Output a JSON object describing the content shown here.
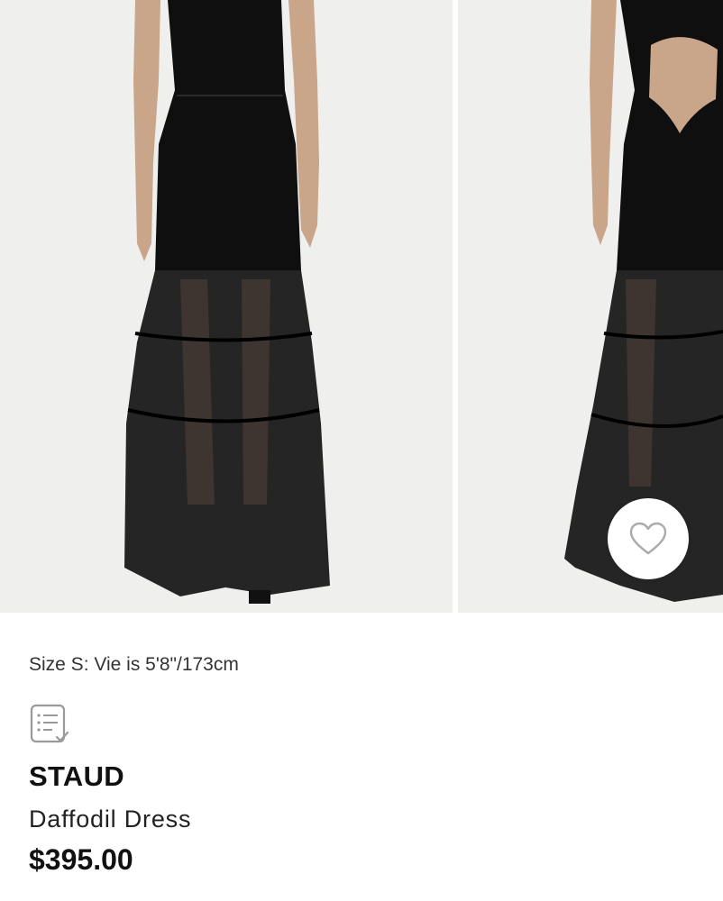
{
  "gallery": {
    "images": [
      {
        "label": "front view"
      },
      {
        "label": "back view"
      }
    ],
    "favorite_icon": "heart-outline-icon"
  },
  "product": {
    "model_info": "Size S: Vie is 5'8\"/173cm",
    "details_icon": "checklist-document-icon",
    "brand": "STAUD",
    "name": "Daffodil Dress",
    "price": "$395.00"
  },
  "colors": {
    "background": "#ffffff",
    "photo_bg": "#efefed",
    "dress": "#0d0d0d",
    "skin": "#c9a58a"
  }
}
